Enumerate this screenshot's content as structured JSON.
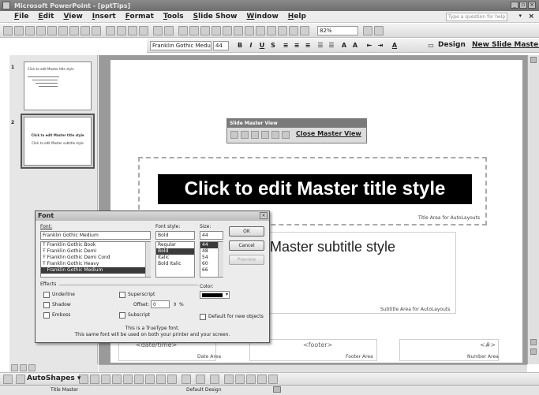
{
  "window": {
    "title": "Microsoft PowerPoint - [pptTips]"
  },
  "menu": [
    "File",
    "Edit",
    "View",
    "Insert",
    "Format",
    "Tools",
    "Slide Show",
    "Window",
    "Help"
  ],
  "help": {
    "placeholder": "Type a question for help"
  },
  "toolbar": {
    "zoom": "82%"
  },
  "formatting": {
    "font_name": "Franklin Gothic Medu",
    "font_size": "44",
    "design_label": "Design",
    "new_master_label": "New Slide Master"
  },
  "thumbnails": [
    {
      "number": "1",
      "title": "Click to edit Master title style"
    },
    {
      "number": "2",
      "title": "Click to edit Master title style",
      "sub": "Click to edit Master subtitle style"
    }
  ],
  "slide_master_toolbar": {
    "title": "Slide Master View",
    "close_label": "Close Master View"
  },
  "slide": {
    "title_text": "Click to edit Master title style",
    "title_area_label": "Title Area for AutoLayouts",
    "subtitle_text": "t Master subtitle style",
    "subtitle_area_label": "Subtitle Area for AutoLayouts",
    "date_text": "<date/time>",
    "date_label": "Date Area",
    "footer_text": "<footer>",
    "footer_label": "Footer Area",
    "number_text": "<#>",
    "number_label": "Number Area"
  },
  "font_dialog": {
    "title": "Font",
    "font_label": "Font:",
    "font_value": "Franklin Gothic Medium",
    "font_list": [
      "Franklin Gothic Book",
      "Franklin Gothic Demi",
      "Franklin Gothic Demi Cond",
      "Franklin Gothic Heavy",
      "Franklin Gothic Medium"
    ],
    "style_label": "Font style:",
    "style_value": "Bold",
    "style_list": [
      "Regular",
      "Bold",
      "Italic",
      "Bold Italic"
    ],
    "size_label": "Size:",
    "size_value": "44",
    "size_list": [
      "44",
      "48",
      "54",
      "60",
      "66"
    ],
    "ok_label": "OK",
    "cancel_label": "Cancel",
    "preview_label": "Preview",
    "effects_label": "Effects",
    "underline_label": "Underline",
    "shadow_label": "Shadow",
    "emboss_label": "Emboss",
    "superscript_label": "Superscript",
    "offset_label": "Offset:",
    "offset_value": "0",
    "offset_unit": "%",
    "subscript_label": "Subscript",
    "color_label": "Color:",
    "default_label": "Default for new objects",
    "info_line1": "This is a TrueType font.",
    "info_line2": "This same font will be used on both your printer and your screen."
  },
  "drawing": {
    "autoshapes_label": "AutoShapes"
  },
  "status": {
    "left": "Title Master",
    "center": "Default Design"
  }
}
